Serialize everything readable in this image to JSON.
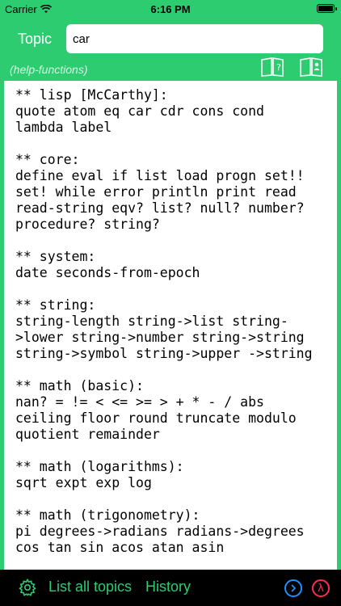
{
  "status_bar": {
    "carrier": "Carrier",
    "time": "6:16 PM"
  },
  "header": {
    "topic_label": "Topic",
    "search_value": "car",
    "hint": "(help-functions)"
  },
  "icons": {
    "book_help": "book-question-icon",
    "book_user": "book-person-icon",
    "settings": "gear-icon",
    "next": "chevron-right-circle-icon",
    "lambda": "lambda-icon"
  },
  "sections": [
    {
      "heading": "** lisp [McCarthy]:",
      "body": "quote atom eq car cdr cons cond\nlambda label"
    },
    {
      "heading": "** core:",
      "body": "define eval if list load progn set!!\nset! while error println print read\nread-string eqv? list? null? number?\nprocedure? string?"
    },
    {
      "heading": "** system:",
      "body": "date seconds-from-epoch"
    },
    {
      "heading": "** string:",
      "body": "string-length string->list string-\n>lower string->number string->string\nstring->symbol string->upper ->string"
    },
    {
      "heading": "** math (basic):",
      "body": "nan? = != < <= >= > + * - / abs\nceiling floor round truncate modulo\nquotient remainder"
    },
    {
      "heading": "** math (logarithms):",
      "body": "sqrt expt exp log"
    },
    {
      "heading": "** math (trigonometry):",
      "body": "pi degrees->radians radians->degrees\ncos tan sin acos atan asin"
    }
  ],
  "bottom_bar": {
    "list_all_topics": "List all topics",
    "history": "History",
    "lambda_symbol": "λ"
  },
  "colors": {
    "accent": "#2ECC71",
    "blue": "#1E90FF",
    "red": "#FF2D55"
  }
}
